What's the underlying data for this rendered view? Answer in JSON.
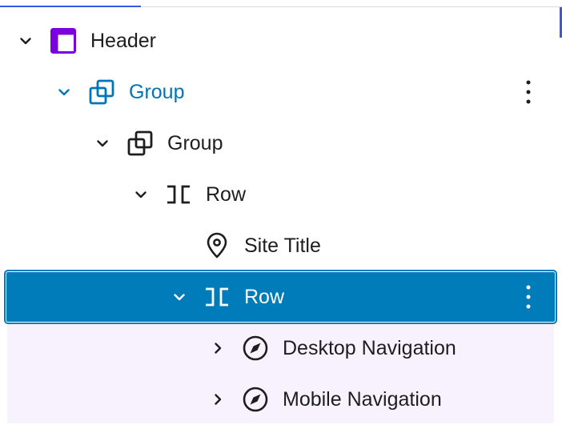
{
  "list_view": {
    "items": [
      {
        "label": "Header",
        "icon": "template-part-icon",
        "expanded": true,
        "level": 1
      },
      {
        "label": "Group",
        "icon": "group-icon",
        "expanded": true,
        "level": 2,
        "highlighted": true
      },
      {
        "label": "Group",
        "icon": "group-icon",
        "expanded": true,
        "level": 3
      },
      {
        "label": "Row",
        "icon": "row-icon",
        "expanded": true,
        "level": 4
      },
      {
        "label": "Site Title",
        "icon": "map-marker-icon",
        "level": 5
      },
      {
        "label": "Row",
        "icon": "row-icon",
        "expanded": true,
        "level": 5,
        "selected": true
      },
      {
        "label": "Desktop Navigation",
        "icon": "navigation-icon",
        "expanded": false,
        "level": 6
      },
      {
        "label": "Mobile Navigation",
        "icon": "navigation-icon",
        "expanded": false,
        "level": 6
      }
    ]
  },
  "colors": {
    "selected": "#007cba",
    "highlighted_text": "#0074b8",
    "template_part_icon": "#7a00df",
    "child_background": "#f7f2fd"
  }
}
